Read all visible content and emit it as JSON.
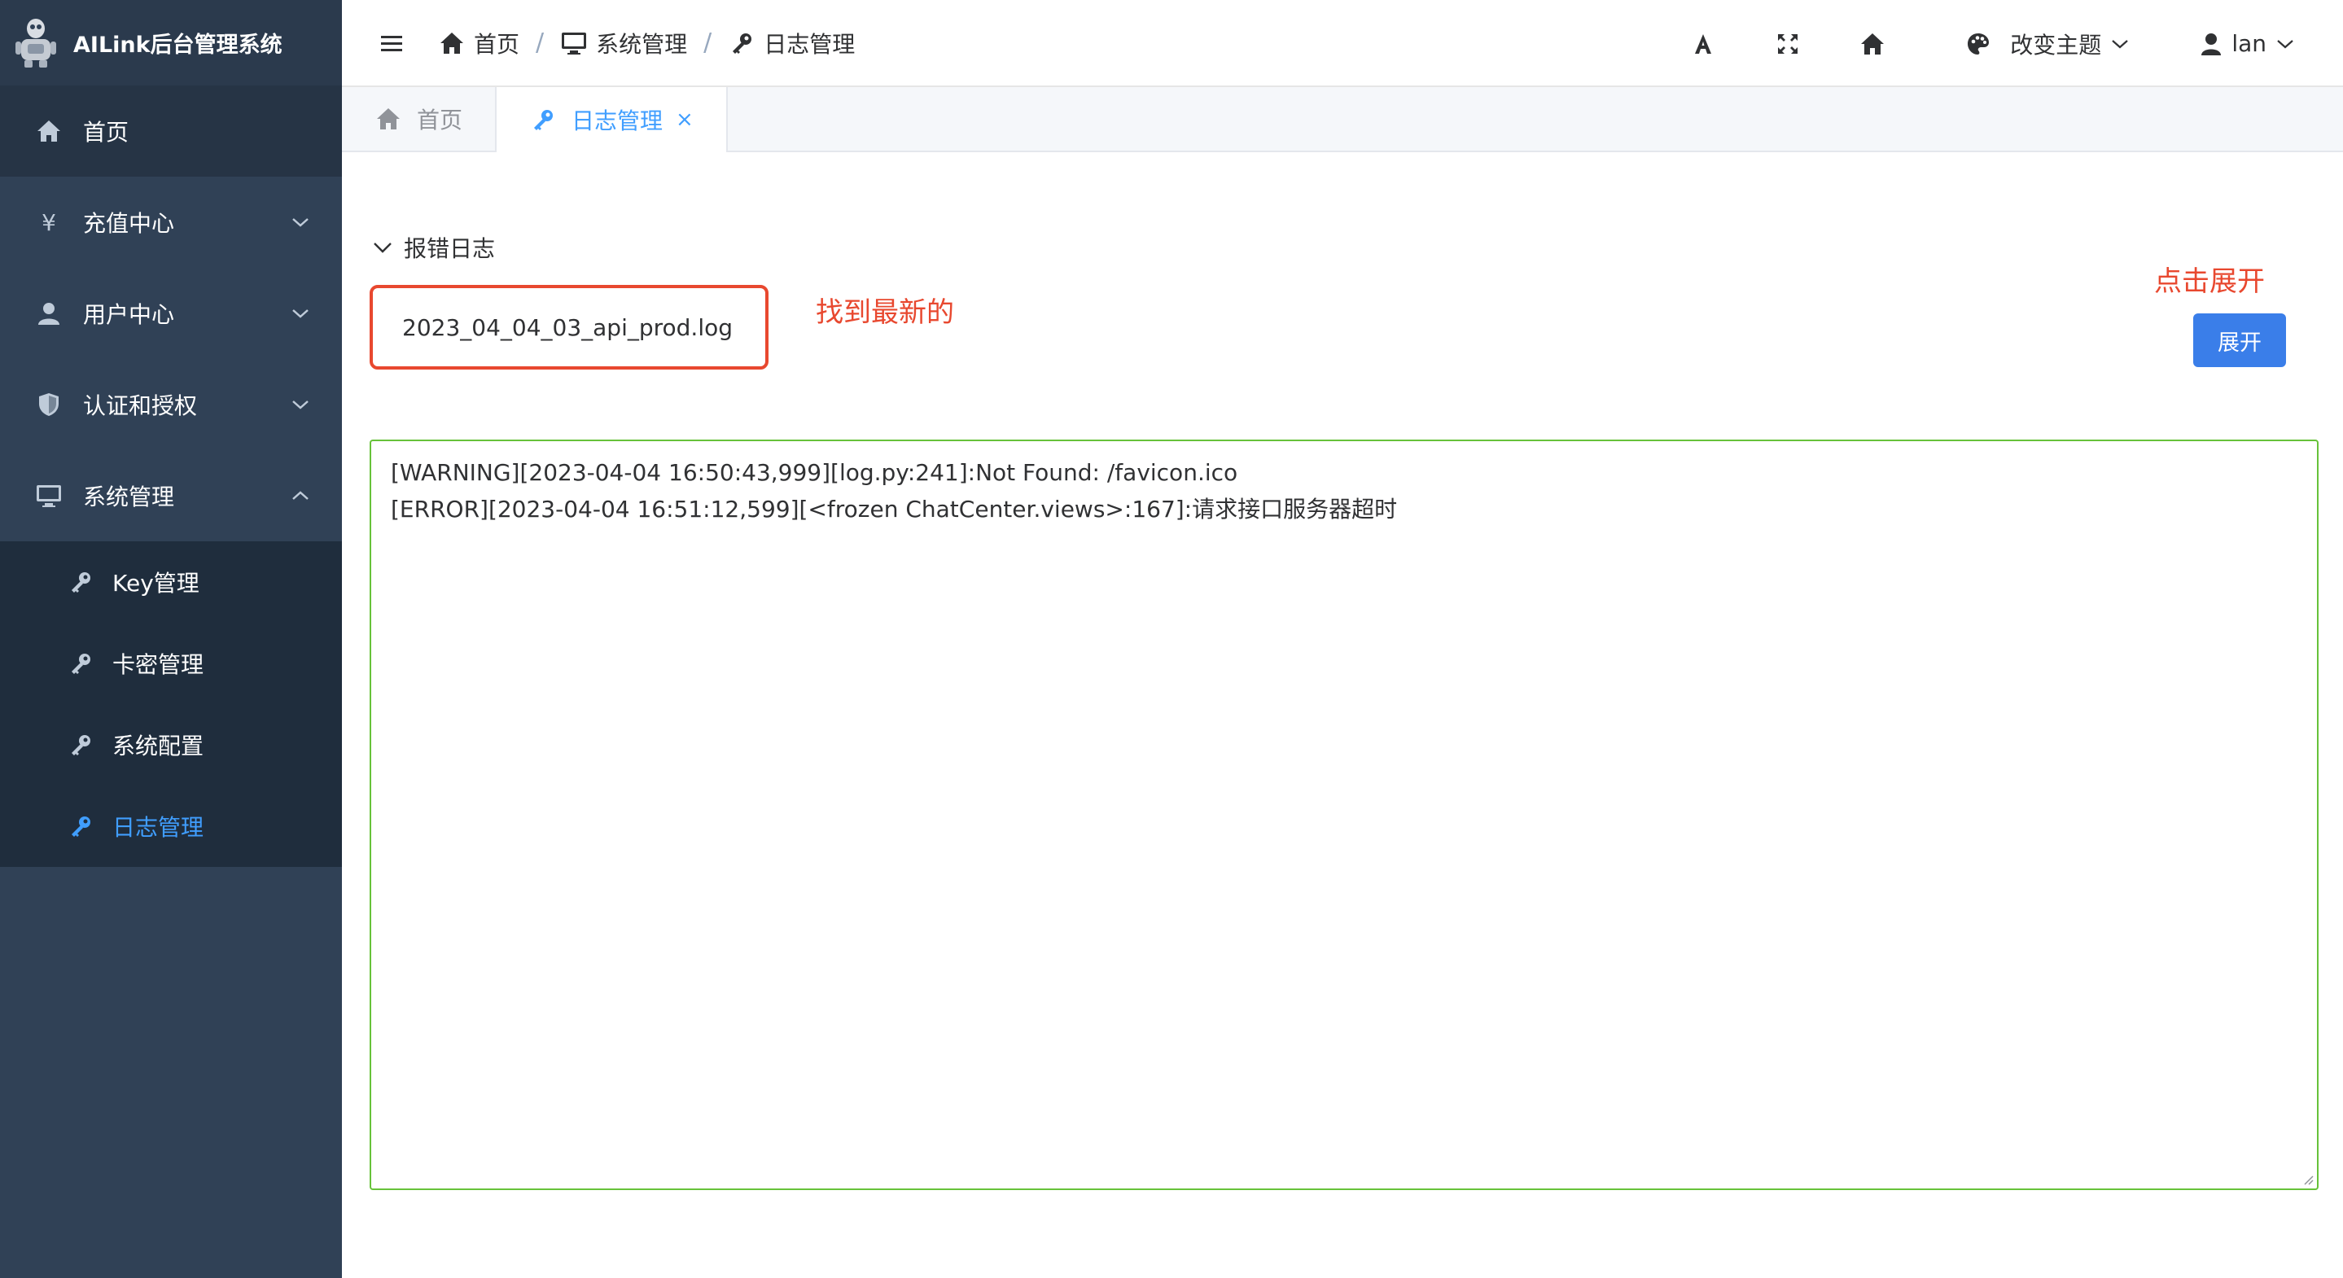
{
  "app": {
    "title": "AILink后台管理系统"
  },
  "sidebar": {
    "items": [
      {
        "label": "首页",
        "icon": "home-icon"
      },
      {
        "label": "充值中心",
        "icon": "yen-icon",
        "expanded": false
      },
      {
        "label": "用户中心",
        "icon": "user-icon",
        "expanded": false
      },
      {
        "label": "认证和授权",
        "icon": "shield-icon",
        "expanded": false
      },
      {
        "label": "系统管理",
        "icon": "monitor-icon",
        "expanded": true
      }
    ],
    "sub_items": [
      {
        "label": "Key管理",
        "icon": "key-icon"
      },
      {
        "label": "卡密管理",
        "icon": "key-icon"
      },
      {
        "label": "系统配置",
        "icon": "key-icon"
      },
      {
        "label": "日志管理",
        "icon": "key-icon",
        "active": true
      }
    ]
  },
  "navbar": {
    "breadcrumb": [
      "首页",
      "系统管理",
      "日志管理"
    ],
    "breadcrumb_sep": "/",
    "theme_label": "改变主题",
    "user_name": "lan"
  },
  "tabs": [
    {
      "label": "首页",
      "icon": "home-icon",
      "active": false
    },
    {
      "label": "日志管理",
      "icon": "key-icon",
      "active": true,
      "close": "×"
    }
  ],
  "main": {
    "section_title": "报错日志",
    "file_name": "2023_04_04_03_api_prod.log",
    "annotation_left": "找到最新的",
    "annotation_right": "点击展开",
    "expand_button": "展开",
    "log_lines": [
      "[WARNING][2023-04-04 16:50:43,999][log.py:241]:Not Found: /favicon.ico",
      "[ERROR][2023-04-04 16:51:12,599][<frozen ChatCenter.views>:167]:请求接口服务器超时"
    ]
  },
  "colors": {
    "sidebar_bg": "#304156",
    "submenu_bg": "#1f2d3d",
    "active_blue": "#409eff",
    "annotation_red": "#e8482f",
    "button_blue": "#3a7ee9",
    "log_border_green": "#67c23a"
  }
}
